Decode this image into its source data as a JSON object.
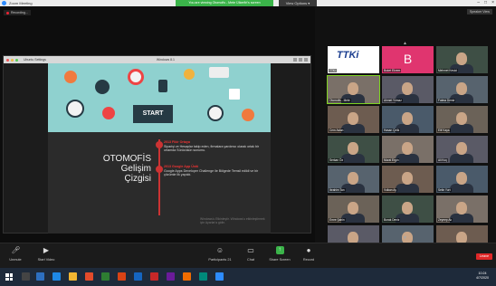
{
  "window": {
    "title": "Zoom Meeting"
  },
  "share_banner": {
    "text": "You are viewing Otomofis - Mete Ülkerfiri's screen"
  },
  "view_options": {
    "label": "View Options ▾"
  },
  "speaker_view": {
    "label": "Speaker View"
  },
  "recording": {
    "label": "Recording..."
  },
  "vm": {
    "title": "Ubuntu Settings",
    "center_title": "Windows 8.1"
  },
  "slide": {
    "start_label": "START",
    "heading": [
      "OTOMOFİS",
      "Gelişim",
      "Çizgisi"
    ],
    "items": [
      {
        "year": "2013",
        "head": "Fikir Ortaya",
        "text": "Siparişi ve Hesaplar takip eden, firmalara yardımcı olarak ortak bir ortamda Sürücüsün sunumu."
      },
      {
        "year": "2013",
        "head": "Google App Üstü",
        "text": "Google Apps Developer Challenge ile Bölgede Temsil edildi ve bir çözümle ilk yapıldı."
      }
    ],
    "watermark": "Windows'u Etkinleştir. Windows'u etkinleştirmek için Ayarlar'a gidin."
  },
  "participants": [
    {
      "name": "TTKi",
      "type": "logo"
    },
    {
      "name": "Buket Ekrem",
      "type": "letter",
      "letter": "B"
    },
    {
      "name": "Mehmet Kesici",
      "type": "video"
    },
    {
      "name": "Otomofis - Mete",
      "type": "video",
      "active": true
    },
    {
      "name": "Ahmet Yılmaz",
      "type": "video"
    },
    {
      "name": "Fatma Demir",
      "type": "video"
    },
    {
      "name": "Cem Aslan",
      "type": "video"
    },
    {
      "name": "Hasan Çelik",
      "type": "video"
    },
    {
      "name": "Elif Kaya",
      "type": "video"
    },
    {
      "name": "Serkan Öz",
      "type": "video"
    },
    {
      "name": "Murat Ergin",
      "type": "video"
    },
    {
      "name": "Ali Koç",
      "type": "video"
    },
    {
      "name": "İbrahim Tan",
      "type": "video"
    },
    {
      "name": "Volkan Ay",
      "type": "video"
    },
    {
      "name": "Selin Yurt",
      "type": "video"
    },
    {
      "name": "Emre Şahin",
      "type": "video"
    },
    {
      "name": "Burak Deniz",
      "type": "video"
    },
    {
      "name": "Zeynep Ak",
      "type": "video"
    },
    {
      "name": "Ömer Kural",
      "type": "video"
    },
    {
      "name": "Levent Ucar",
      "type": "video"
    },
    {
      "name": "Nur Erdem",
      "type": "video"
    }
  ],
  "toolbar": {
    "unmute": "Unmute",
    "start_video": "Start Video",
    "participants": "Participants",
    "participants_count": "21",
    "chat": "Chat",
    "share_screen": "Share Screen",
    "record": "Record",
    "end": "Leave"
  },
  "clock": {
    "time": "10:24",
    "date": "4/7/2020"
  },
  "colors": {
    "share_green": "#3bb44a",
    "end_red": "#e02828",
    "slide_teal": "#8fd1cf",
    "accent_red": "#c33"
  }
}
